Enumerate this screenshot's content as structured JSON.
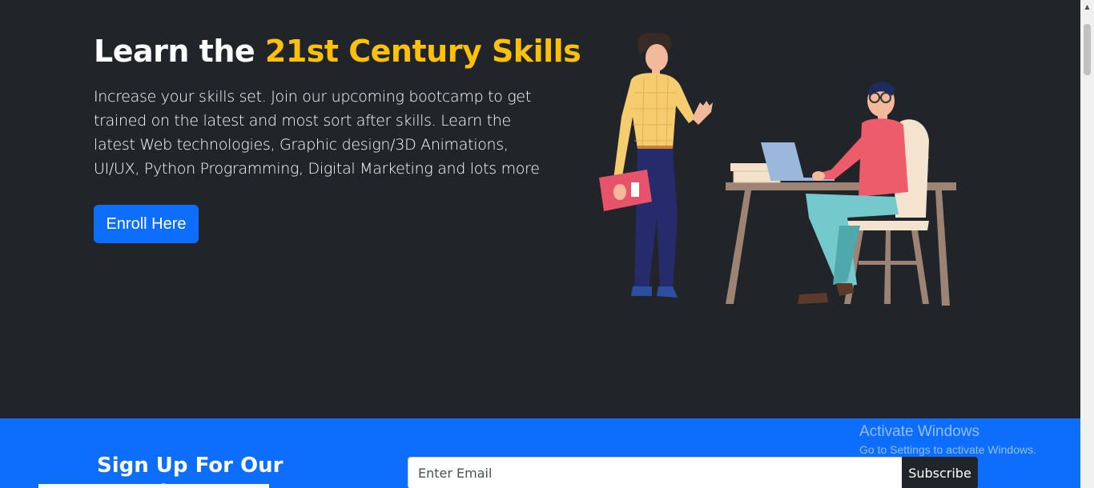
{
  "hero": {
    "title_prefix": "Learn the ",
    "title_accent": "21st Century Skills",
    "description": "Increase your skills set. Join our upcoming bootcamp to get trained on the latest and most sort after skills. Learn the latest Web technologies, Graphic design/3D Animations, UI/UX, Python Programming, Digital Marketing and lots more",
    "enroll_label": "Enroll Here",
    "illustration": "people-working-illustration"
  },
  "newsletter": {
    "title": "Sign Up For Our Newsletter",
    "email_placeholder": "Enter Email",
    "subscribe_label": "Subscribe"
  },
  "watermark": {
    "title": "Activate Windows",
    "subtitle": "Go to Settings to activate Windows."
  },
  "colors": {
    "dark_bg": "#212529",
    "accent": "#ffc107",
    "primary": "#0d6efd"
  }
}
